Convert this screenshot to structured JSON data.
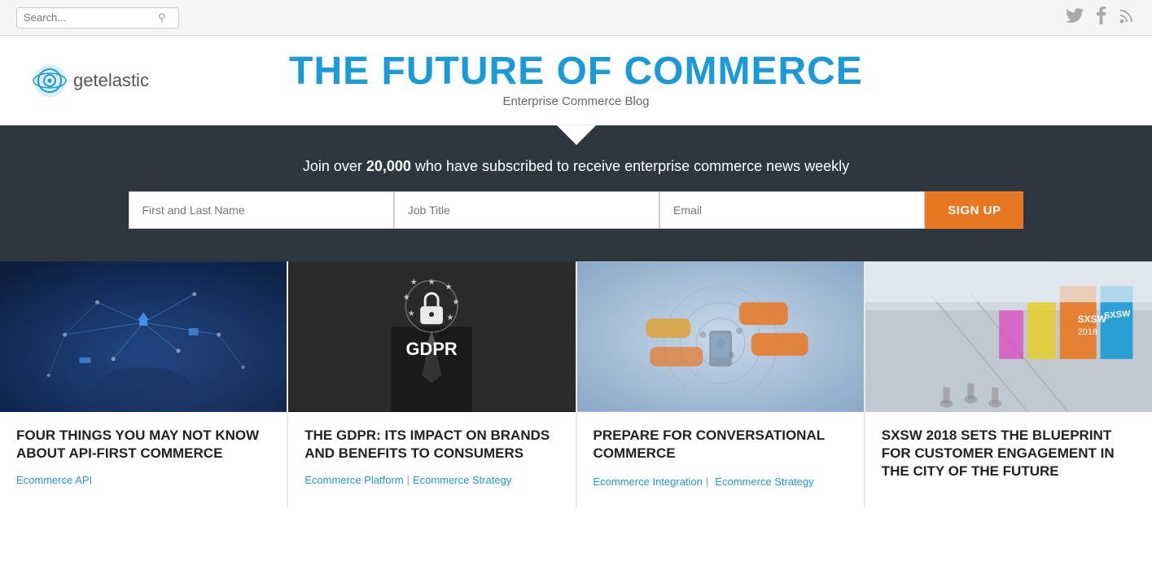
{
  "topbar": {
    "search_placeholder": "Search...",
    "search_icon": "🔍",
    "social": [
      {
        "name": "twitter-icon",
        "glyph": "🐦"
      },
      {
        "name": "facebook-icon",
        "glyph": "f"
      },
      {
        "name": "rss-icon",
        "glyph": "⊕"
      }
    ]
  },
  "header": {
    "logo_text": "getelastic",
    "site_title": "THE FUTURE OF COMMERCE",
    "site_subtitle": "Enterprise Commerce Blog"
  },
  "subscribe": {
    "text_prefix": "Join over ",
    "text_highlight": "20,000",
    "text_suffix": " who have subscribed to receive enterprise commerce news weekly",
    "name_placeholder": "First and Last Name",
    "title_placeholder": "Job Title",
    "email_placeholder": "Email",
    "button_label": "SIGN UP"
  },
  "cards": [
    {
      "title": "FOUR THINGS YOU MAY NOT KNOW ABOUT API-FIRST COMMERCE",
      "image_type": "network",
      "tags": [
        {
          "label": "Ecommerce API",
          "href": "#"
        }
      ],
      "tag_dividers": []
    },
    {
      "title": "THE GDPR: ITS IMPACT ON BRANDS AND BENEFITS TO CONSUMERS",
      "image_type": "gdpr",
      "gdpr_label": "GDPR",
      "tags": [
        {
          "label": "Ecommerce Platform",
          "href": "#"
        },
        {
          "label": "Ecommerce Strategy",
          "href": "#"
        }
      ],
      "tag_dividers": [
        1
      ]
    },
    {
      "title": "PREPARE FOR CONVERSATIONAL COMMERCE",
      "image_type": "chat",
      "tags": [
        {
          "label": "Ecommerce Integration",
          "href": "#"
        },
        {
          "label": "Ecommerce Strategy",
          "href": "#"
        }
      ],
      "tag_dividers": [
        1
      ]
    },
    {
      "title": "SXSW 2018 SETS THE BLUEPRINT FOR CUSTOMER ENGAGEMENT IN THE CITY OF THE FUTURE",
      "image_type": "sxsw",
      "tags": [],
      "tag_dividers": []
    }
  ]
}
